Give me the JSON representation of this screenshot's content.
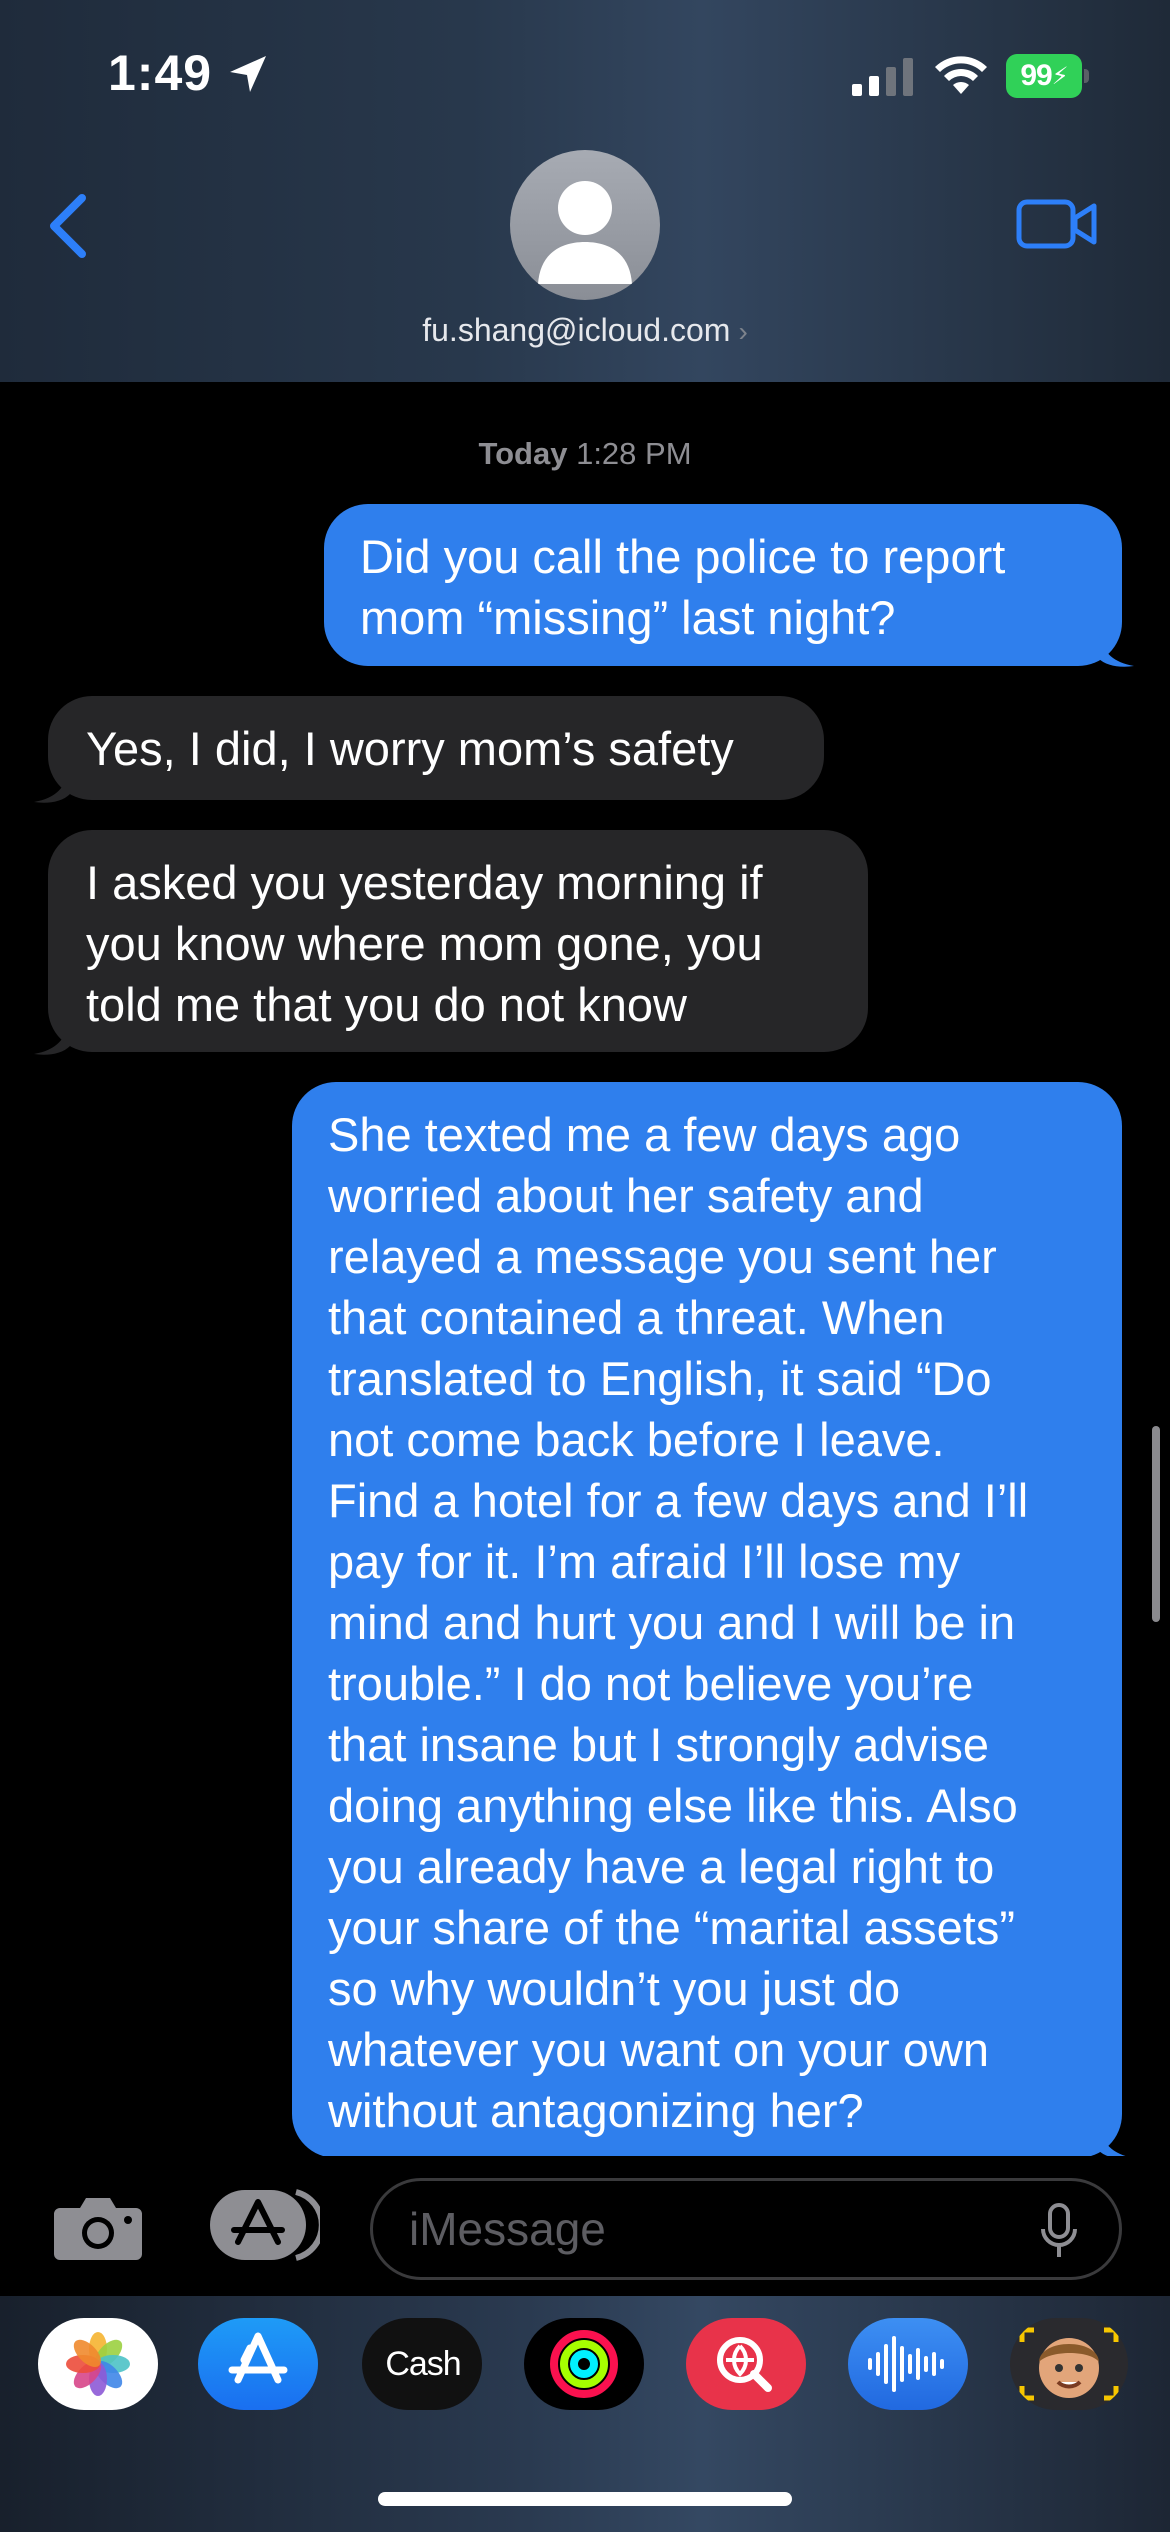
{
  "status_bar": {
    "time": "1:49",
    "battery": "99"
  },
  "header": {
    "contact": "fu.shang@icloud.com",
    "chevron": "›"
  },
  "conversation": {
    "timestamp_day": "Today",
    "timestamp_time": "1:28 PM",
    "messages": [
      {
        "direction": "sent",
        "lines": [
          "Did you call the police to report",
          "mom “missing” last night?"
        ]
      },
      {
        "direction": "received",
        "lines": [
          "Yes, I did, I worry mom’s safety"
        ]
      },
      {
        "direction": "received",
        "lines": [
          "I asked you yesterday morning if",
          "you know where mom gone, you",
          "told me that you do not know"
        ]
      },
      {
        "direction": "sent",
        "lines": [
          "She texted me a few days ago",
          "worried about her safety and",
          "relayed a message you sent her",
          "that contained a threat. When",
          "translated to English, it said “Do",
          "not come back before I leave.",
          "Find a hotel for a few days and I’ll",
          "pay for it. I’m afraid I’ll lose my",
          "mind and hurt you and I will be in",
          "trouble.” I do not believe you’re",
          "that insane but I strongly advise",
          "doing anything else like this. Also",
          "you already have a legal right to",
          "your share of the “marital assets”",
          "so why wouldn’t you just do",
          "whatever you want on your own",
          "without antagonizing her?"
        ]
      }
    ]
  },
  "compose": {
    "placeholder": "iMessage"
  },
  "app_drawer": {
    "apps": [
      {
        "name": "photos-app-icon"
      },
      {
        "name": "app-store-app-icon"
      },
      {
        "name": "apple-cash-app-icon",
        "label": "Cash"
      },
      {
        "name": "fitness-app-icon"
      },
      {
        "name": "images-search-app-icon"
      },
      {
        "name": "audio-message-app-icon"
      },
      {
        "name": "memoji-app-icon"
      }
    ]
  },
  "colors": {
    "sent_bubble": "#2f7fed",
    "received_bubble": "#262628",
    "accent": "#2d7ff9",
    "battery": "#30d158"
  }
}
